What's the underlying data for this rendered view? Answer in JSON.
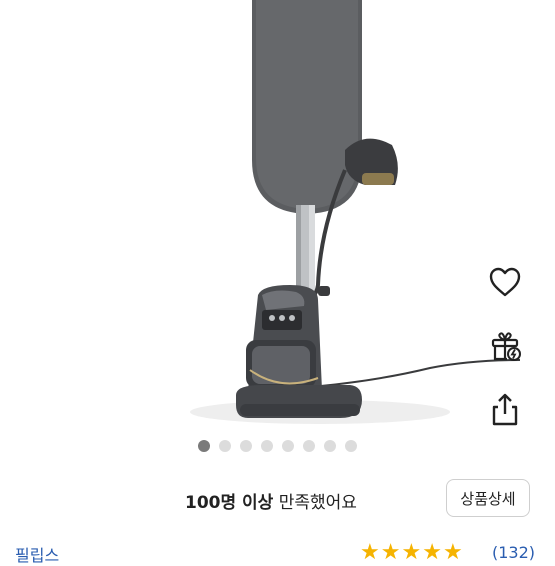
{
  "gallery": {
    "total_images": 8,
    "active_index": 0
  },
  "side_actions": {
    "like_icon": "heart-icon",
    "gift_icon": "gift-icon",
    "share_icon": "share-icon"
  },
  "satisfaction": {
    "count_text": "100명 이상",
    "suffix_text": " 만족했어요"
  },
  "detail_button": {
    "label": "상품상세"
  },
  "brand": {
    "name": "필립스"
  },
  "rating": {
    "stars": 5,
    "star_color": "#f5b301",
    "review_count_text": "(132)"
  },
  "colors": {
    "link": "#2a5db0",
    "dot_active": "#7a7a7a",
    "dot_inactive": "#dcdcdc"
  }
}
